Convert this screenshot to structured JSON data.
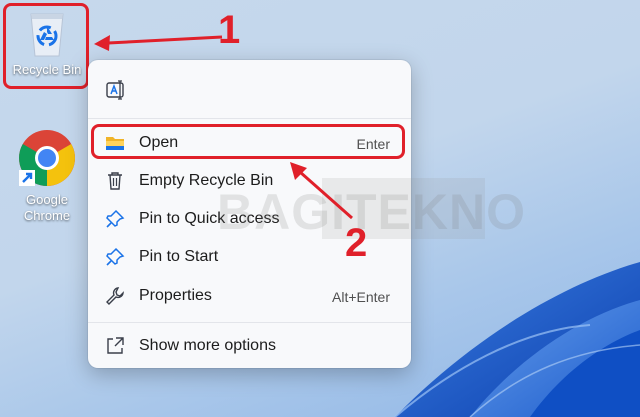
{
  "desktop": {
    "icons": [
      {
        "label": "Recycle Bin",
        "icon": "recycle-bin-icon"
      },
      {
        "label": "Google\nChrome",
        "icon": "chrome-icon"
      }
    ]
  },
  "context_menu": {
    "top_icons": [
      {
        "name": "rename-icon"
      }
    ],
    "items": [
      {
        "label": "Open",
        "shortcut": "Enter",
        "icon": "folder-icon"
      },
      {
        "label": "Empty Recycle Bin",
        "shortcut": "",
        "icon": "trash-icon"
      },
      {
        "label": "Pin to Quick access",
        "shortcut": "",
        "icon": "pin-icon"
      },
      {
        "label": "Pin to Start",
        "shortcut": "",
        "icon": "pin-icon"
      },
      {
        "label": "Properties",
        "shortcut": "Alt+Enter",
        "icon": "wrench-icon"
      },
      {
        "label": "Show more options",
        "shortcut": "",
        "icon": "share-icon"
      }
    ]
  },
  "annotations": {
    "step1": "1",
    "step2": "2",
    "highlight_color": "#e0202a"
  },
  "watermark": "BAGITEKNO"
}
